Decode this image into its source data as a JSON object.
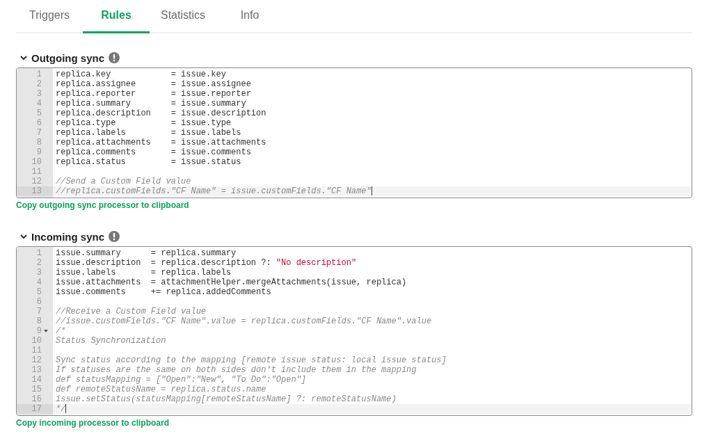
{
  "tabs": [
    {
      "label": "Triggers",
      "selected": false
    },
    {
      "label": "Rules",
      "selected": true
    },
    {
      "label": "Statistics",
      "selected": false
    },
    {
      "label": "Info",
      "selected": false
    }
  ],
  "sections": [
    {
      "title": "Outgoing sync",
      "expanded": true,
      "copy_link": "Copy outgoing sync processor to clipboard",
      "lines": [
        {
          "number": "1",
          "active": false,
          "foldable": false,
          "segments": [
            {
              "kind": "code",
              "text": "replica.key            = issue.key"
            }
          ]
        },
        {
          "number": "2",
          "active": false,
          "foldable": false,
          "segments": [
            {
              "kind": "code",
              "text": "replica.assignee       = issue.assignee"
            }
          ]
        },
        {
          "number": "3",
          "active": false,
          "foldable": false,
          "segments": [
            {
              "kind": "code",
              "text": "replica.reporter       = issue.reporter"
            }
          ]
        },
        {
          "number": "4",
          "active": false,
          "foldable": false,
          "segments": [
            {
              "kind": "code",
              "text": "replica.summary        = issue.summary"
            }
          ]
        },
        {
          "number": "5",
          "active": false,
          "foldable": false,
          "segments": [
            {
              "kind": "code",
              "text": "replica.description    = issue.description"
            }
          ]
        },
        {
          "number": "6",
          "active": false,
          "foldable": false,
          "segments": [
            {
              "kind": "code",
              "text": "replica.type           = issue.type"
            }
          ]
        },
        {
          "number": "7",
          "active": false,
          "foldable": false,
          "segments": [
            {
              "kind": "code",
              "text": "replica.labels         = issue.labels"
            }
          ]
        },
        {
          "number": "8",
          "active": false,
          "foldable": false,
          "segments": [
            {
              "kind": "code",
              "text": "replica.attachments    = issue.attachments"
            }
          ]
        },
        {
          "number": "9",
          "active": false,
          "foldable": false,
          "segments": [
            {
              "kind": "code",
              "text": "replica.comments       = issue.comments"
            }
          ]
        },
        {
          "number": "10",
          "active": false,
          "foldable": false,
          "segments": [
            {
              "kind": "code",
              "text": "replica.status         = issue.status"
            }
          ]
        },
        {
          "number": "11",
          "active": false,
          "foldable": false
        },
        {
          "number": "12",
          "active": false,
          "foldable": false,
          "segments": [
            {
              "kind": "comment",
              "text": "//Send a Custom Field value"
            }
          ]
        },
        {
          "number": "13",
          "active": true,
          "foldable": false,
          "segments": [
            {
              "kind": "comment",
              "text": "//replica.customFields.\"CF Name\" = issue.customFields.\"CF Name\""
            }
          ]
        }
      ]
    },
    {
      "title": "Incoming sync",
      "expanded": true,
      "copy_link": "Copy incoming processor to clipboard",
      "lines": [
        {
          "number": "1",
          "active": false,
          "foldable": false,
          "segments": [
            {
              "kind": "code",
              "text": "issue.summary      = replica.summary"
            }
          ]
        },
        {
          "number": "2",
          "active": false,
          "foldable": false,
          "segments": [
            {
              "kind": "code",
              "text": "issue.description  = replica.description ?: "
            },
            {
              "kind": "string",
              "text": "\"No description\""
            }
          ]
        },
        {
          "number": "3",
          "active": false,
          "foldable": false,
          "segments": [
            {
              "kind": "code",
              "text": "issue.labels       = replica.labels"
            }
          ]
        },
        {
          "number": "4",
          "active": false,
          "foldable": false,
          "segments": [
            {
              "kind": "code",
              "text": "issue.attachments  = attachmentHelper.mergeAttachments(issue, replica)"
            }
          ]
        },
        {
          "number": "5",
          "active": false,
          "foldable": false,
          "segments": [
            {
              "kind": "code",
              "text": "issue.comments     += replica.addedComments"
            }
          ]
        },
        {
          "number": "6",
          "active": false,
          "foldable": false
        },
        {
          "number": "7",
          "active": false,
          "foldable": false,
          "segments": [
            {
              "kind": "comment",
              "text": "//Receive a Custom Field value"
            }
          ]
        },
        {
          "number": "8",
          "active": false,
          "foldable": false,
          "segments": [
            {
              "kind": "comment",
              "text": "//issue.customFields.\"CF Name\".value = replica.customFields.\"CF Name\".value"
            }
          ]
        },
        {
          "number": "9",
          "active": false,
          "foldable": true,
          "segments": [
            {
              "kind": "comment",
              "text": "/*"
            }
          ]
        },
        {
          "number": "10",
          "active": false,
          "foldable": false,
          "segments": [
            {
              "kind": "comment",
              "text": "Status Synchronization"
            }
          ]
        },
        {
          "number": "11",
          "active": false,
          "foldable": false
        },
        {
          "number": "12",
          "active": false,
          "foldable": false,
          "segments": [
            {
              "kind": "comment",
              "text": "Sync status according to the mapping [remote issue status: local issue status]"
            }
          ]
        },
        {
          "number": "13",
          "active": false,
          "foldable": false,
          "segments": [
            {
              "kind": "comment",
              "text": "If statuses are the same on both sides don't include them in the mapping"
            }
          ]
        },
        {
          "number": "14",
          "active": false,
          "foldable": false,
          "segments": [
            {
              "kind": "comment",
              "text": "def statusMapping = [\"Open\":\"New\", \"To Do\":\"Open\"]"
            }
          ]
        },
        {
          "number": "15",
          "active": false,
          "foldable": false,
          "segments": [
            {
              "kind": "comment",
              "text": "def remoteStatusName = replica.status.name"
            }
          ]
        },
        {
          "number": "16",
          "active": false,
          "foldable": false,
          "segments": [
            {
              "kind": "comment",
              "text": "issue.setStatus(statusMapping[remoteStatusName] ?: remoteStatusName)"
            }
          ]
        },
        {
          "number": "17",
          "active": true,
          "foldable": false,
          "segments": [
            {
              "kind": "comment",
              "text": "*/"
            }
          ]
        }
      ]
    }
  ]
}
